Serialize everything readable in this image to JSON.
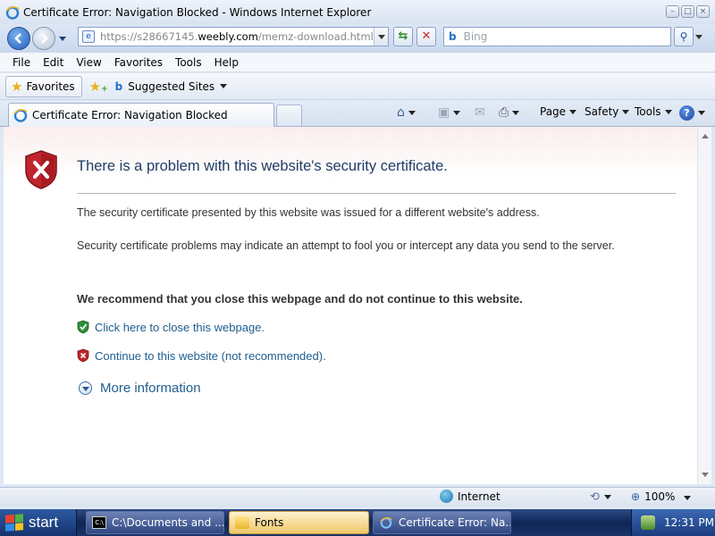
{
  "window": {
    "title": "Certificate Error: Navigation Blocked - Windows Internet Explorer",
    "controls": [
      "minimize",
      "maximize",
      "close"
    ]
  },
  "address_bar": {
    "url_prefix": "https://s28667145.",
    "url_domain": "weebly.com",
    "url_path": "/memz-download.html",
    "search_placeholder": "Bing",
    "search_provider": "b"
  },
  "menu": [
    "File",
    "Edit",
    "View",
    "Favorites",
    "Tools",
    "Help"
  ],
  "favorites_bar": {
    "favorites_label": "Favorites",
    "suggested_sites_label": "Suggested Sites",
    "bing_mark": "b"
  },
  "tabs": {
    "active_tab_label": "Certificate Error: Navigation Blocked"
  },
  "command_bar": {
    "page_label": "Page",
    "safety_label": "Safety",
    "tools_label": "Tools",
    "help_glyph": "?"
  },
  "content": {
    "heading": "There is a problem with this website's security certificate.",
    "paragraph_1": "The security certificate presented by this website was issued for a different website's address.",
    "paragraph_2": "Security certificate problems may indicate an attempt to fool you or intercept any data you send to the server.",
    "recommendation": "We recommend that you close this webpage and do not continue to this website.",
    "close_link": "Click here to close this webpage.",
    "continue_link": "Continue to this website (not recommended).",
    "more_info": "More information",
    "colors": {
      "heading": "#1f3d66",
      "link": "#1e5d8f",
      "error_shield": "#c0262d",
      "safe_shield": "#2f8f3a"
    }
  },
  "status_bar": {
    "zone": "Internet",
    "zoom": "100%"
  },
  "taskbar": {
    "start_label": "start",
    "tasks": [
      {
        "label": "C:\\Documents and ..."
      },
      {
        "label": "Fonts"
      },
      {
        "label": "Certificate Error: Na..."
      }
    ],
    "clock": "12:31 PM"
  }
}
